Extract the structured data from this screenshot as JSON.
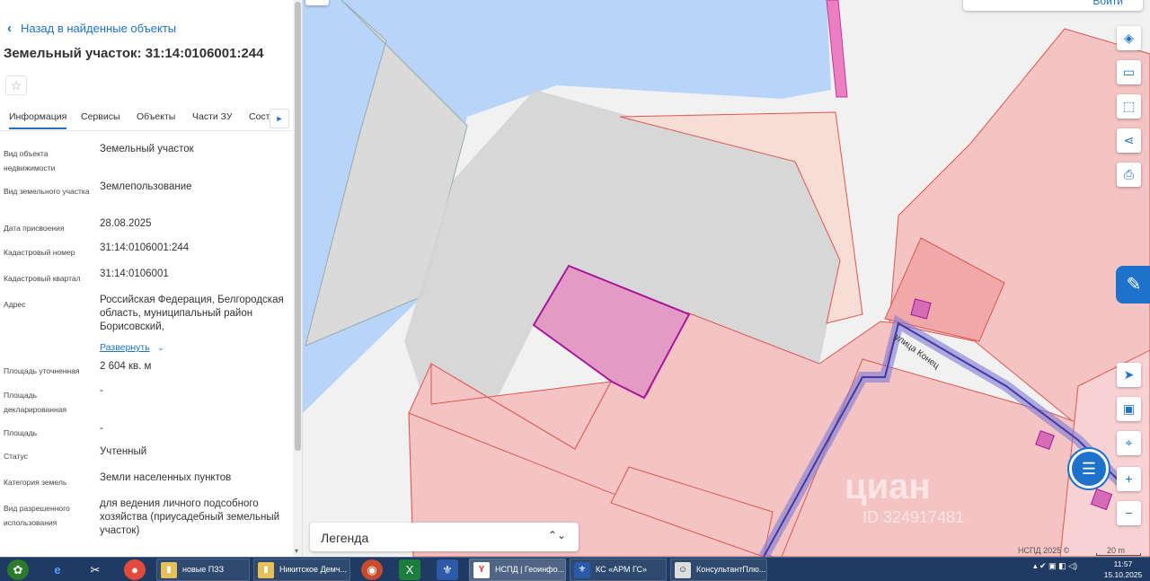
{
  "panel": {
    "back_label": "Назад в найденные объекты",
    "title": "Земельный участок: 31:14:0106001:244",
    "tabs": [
      "Информация",
      "Сервисы",
      "Объекты",
      "Части ЗУ",
      "Соста"
    ],
    "rows": [
      {
        "label": "Вид объекта недвижимости",
        "value": "Земельный участок"
      },
      {
        "label": "Вид земельного участка",
        "value": "Землепользование"
      },
      {
        "label": "Дата присвоения",
        "value": "28.08.2025"
      },
      {
        "label": "Кадастровый номер",
        "value": "31:14:0106001:244"
      },
      {
        "label": "Кадастровый квартал",
        "value": "31:14:0106001"
      },
      {
        "label": "Адрес",
        "value": "Российская Федерация, Белгородская область, муниципальный район Борисовский,"
      },
      {
        "label": "Площадь уточненная",
        "value": "2 604 кв. м"
      },
      {
        "label": "Площадь декларированная",
        "value": "-"
      },
      {
        "label": "Площадь",
        "value": "-"
      },
      {
        "label": "Статус",
        "value": "Учтенный"
      },
      {
        "label": "Категория земель",
        "value": "Земли населенных пунктов"
      },
      {
        "label": "Вид разрешенного использования",
        "value": "для ведения личного подсобного хозяйства (приусадебный земельный участок)"
      }
    ],
    "expand_label": "Развернуть"
  },
  "map": {
    "login_label": "Войти",
    "street_label": "улица Конец",
    "watermark": "циан",
    "watermark_id": "ID 324917481",
    "legend_label": "Легенда",
    "copyright": "НСПД 2025 ©",
    "scale_label": "20 m",
    "tools": [
      "layers-icon",
      "ruler-icon",
      "select-area-icon",
      "share-icon",
      "print-icon",
      "navigate-icon",
      "minimap-icon",
      "location-icon",
      "zoom-in-icon",
      "zoom-out-icon"
    ]
  },
  "taskbar": {
    "apps": [
      {
        "label": "новые ПЗЗ",
        "icon": "folder-icon"
      },
      {
        "label": "Никитское Демч...",
        "icon": "folder-icon"
      },
      {
        "label": "НСПД | Геоинфо...",
        "icon": "yandex-icon"
      },
      {
        "label": "КС «АРМ ГС»",
        "icon": "emblem-icon"
      },
      {
        "label": "КонсультантПлю...",
        "icon": "consultant-icon"
      }
    ],
    "time": "11:57",
    "date": "15.10.2025"
  },
  "colors": {
    "accent": "#1e72c9",
    "parcel_fill": "#f4c3c3",
    "parcel_stroke": "#e0574f",
    "selected_fill": "#e39bc4",
    "selected_stroke": "#a8179a",
    "water": "#b8d4f8",
    "road": "#6b67c9"
  }
}
